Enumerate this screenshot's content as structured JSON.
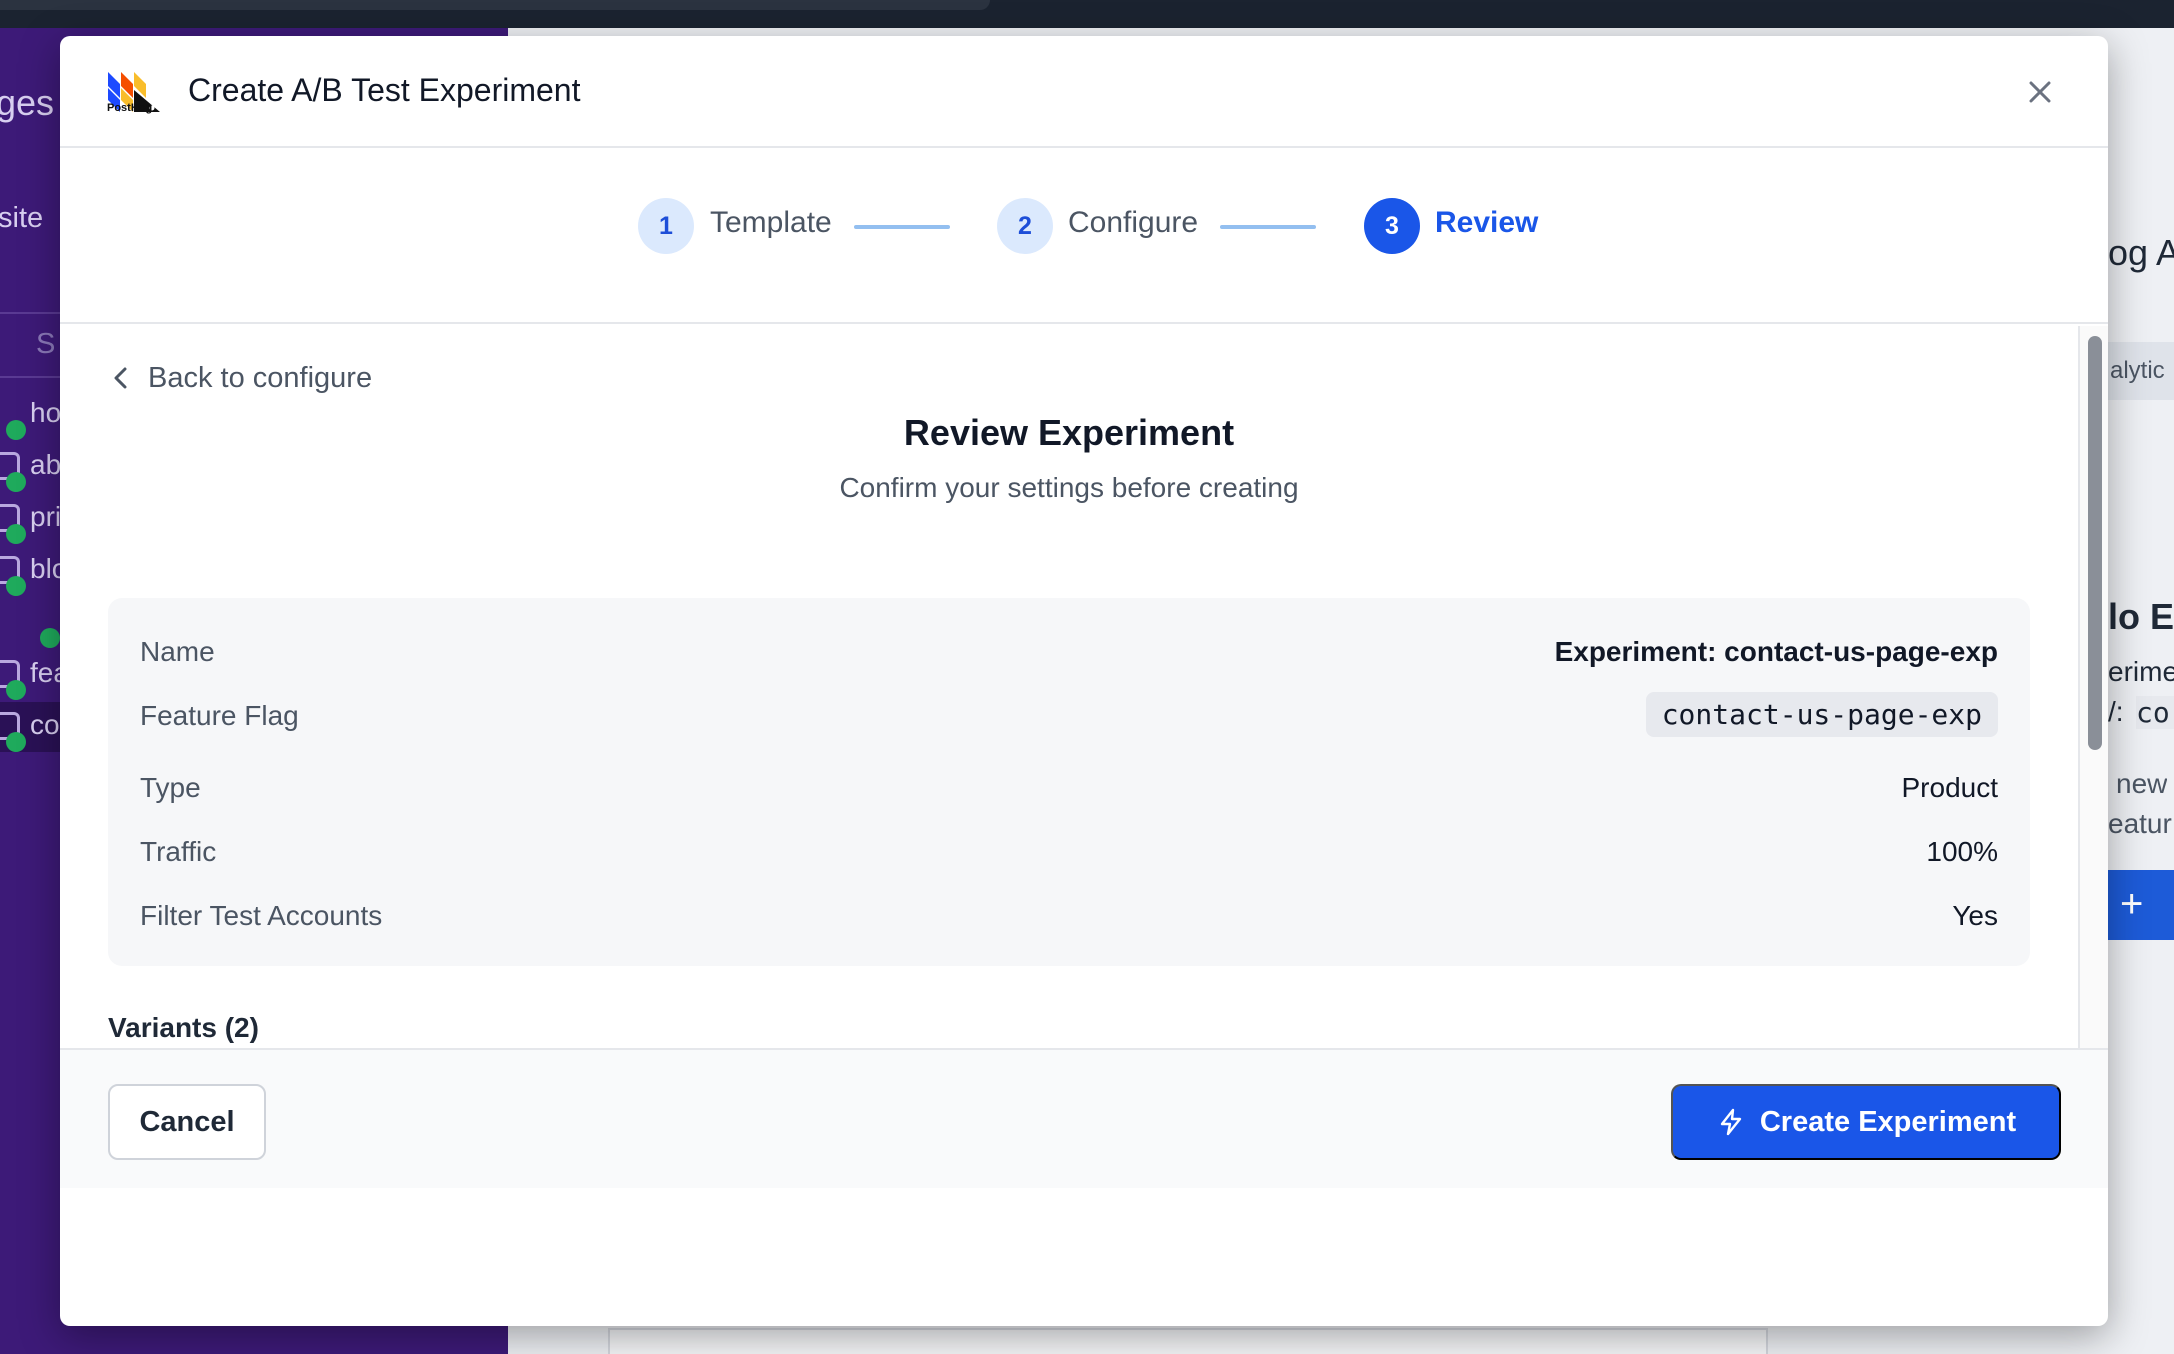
{
  "background": {
    "sidebar_partial_labels": [
      "ges",
      "site",
      "S",
      "ho",
      "ab",
      "pri",
      "blo",
      "fea",
      "co"
    ],
    "right_partial_labels": [
      "og An",
      "alytic",
      "lo Ex",
      "erime",
      "/: ",
      "cor",
      "new",
      "eatur",
      "+"
    ]
  },
  "modal": {
    "title": "Create A/B Test Experiment",
    "logo_text": "PostHog",
    "steps": [
      {
        "number": "1",
        "label": "Template"
      },
      {
        "number": "2",
        "label": "Configure"
      },
      {
        "number": "3",
        "label": "Review"
      }
    ],
    "back_label": "Back to configure",
    "review_title": "Review Experiment",
    "review_subtitle": "Confirm your settings before creating",
    "summary": {
      "name_label": "Name",
      "name_value": "Experiment: contact-us-page-exp",
      "flag_label": "Feature Flag",
      "flag_value": "contact-us-page-exp",
      "type_label": "Type",
      "type_value": "Product",
      "traffic_label": "Traffic",
      "traffic_value": "100%",
      "filter_label": "Filter Test Accounts",
      "filter_value": "Yes"
    },
    "variants_heading": "Variants (2)",
    "cancel_label": "Cancel",
    "create_label": "Create Experiment"
  },
  "colors": {
    "accent": "#1a56e8",
    "step_inactive_bg": "#dbe9fd",
    "sidebar_bg": "#3d1a78"
  }
}
